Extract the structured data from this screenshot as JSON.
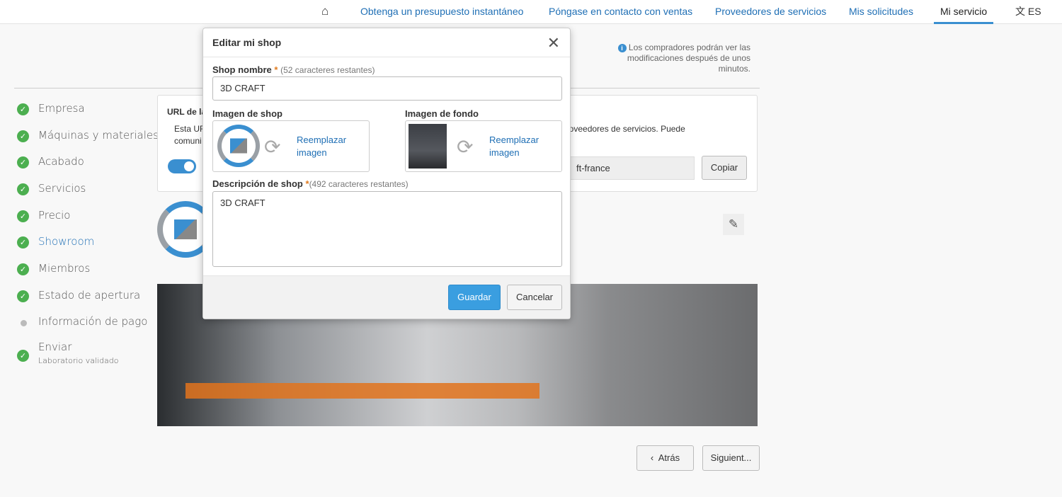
{
  "nav": {
    "home_icon": "home-icon",
    "items": [
      "Obtenga un presupuesto instantáneo",
      "Póngase en contacto con ventas",
      "Proveedores de servicios",
      "Mis solicitudes",
      "Mi servicio"
    ],
    "lang": "ES",
    "lang_icon": "translate-icon"
  },
  "info_note": "Los compradores podrán ver las modificaciones después de unos minutos.",
  "steps": [
    {
      "label": "Empresa",
      "done": true
    },
    {
      "label": "Máquinas y materiales",
      "done": true
    },
    {
      "label": "Acabado",
      "done": true
    },
    {
      "label": "Servicios",
      "done": true
    },
    {
      "label": "Precio",
      "done": true
    },
    {
      "label": "Showroom",
      "done": true,
      "active": true
    },
    {
      "label": "Miembros",
      "done": true
    },
    {
      "label": "Estado de apertura",
      "done": true
    },
    {
      "label": "Información de pago",
      "done": false
    },
    {
      "label": "Enviar",
      "sub": "Laboratorio validado",
      "done": true
    }
  ],
  "url_card": {
    "title": "URL de la",
    "text1": "Esta UR",
    "text1_right": "proveedores de servicios. Puede",
    "text2": "comuni",
    "url_value": "ft-france",
    "copy": "Copiar",
    "toggle_on": true
  },
  "footer": {
    "back": "Atrás",
    "next": "Siguient..."
  },
  "modal": {
    "title": "Editar mi shop",
    "name_label": "Shop nombre",
    "name_hint": "(52 caracteres restantes)",
    "name_value": "3D CRAFT",
    "shop_image_label": "Imagen de shop",
    "bg_image_label": "Imagen de fondo",
    "replace": "Reemplazar imagen",
    "desc_label": "Descripción de shop",
    "desc_hint": "(492 caracteres restantes)",
    "desc_value": "3D CRAFT",
    "save": "Guardar",
    "cancel": "Cancelar"
  },
  "colors": {
    "accent": "#3a8fd0",
    "link": "#1f6fb5",
    "check": "#4caf50",
    "required": "#e07b20"
  }
}
